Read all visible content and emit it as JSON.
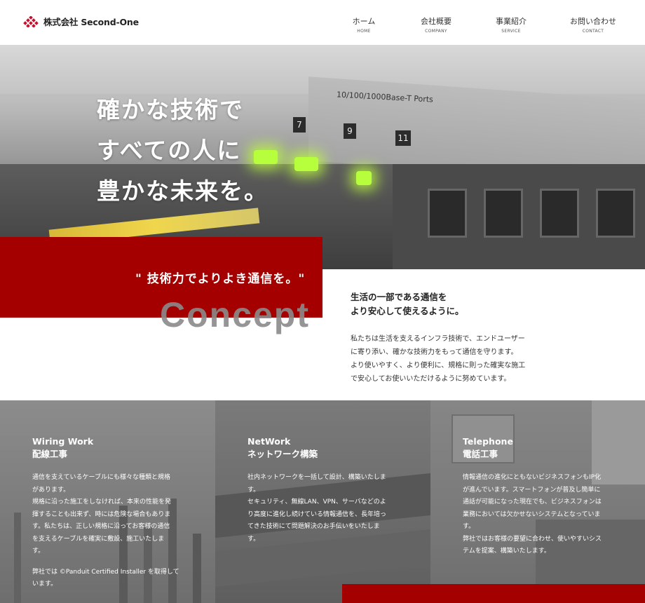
{
  "header": {
    "logo_text": "株式会社 Second-One",
    "nav": [
      {
        "jp": "ホーム",
        "en": "HOME"
      },
      {
        "jp": "会社概要",
        "en": "COMPANY"
      },
      {
        "jp": "事業紹介",
        "en": "SERVICE"
      },
      {
        "jp": "お問い合わせ",
        "en": "CONTACT"
      }
    ]
  },
  "hero": {
    "lines": [
      "確かな技術で",
      "すべての人に",
      "豊かな未来を。"
    ],
    "photo_label": "10/100/1000Base-T Ports",
    "port_numbers": [
      "7",
      "9",
      "11"
    ]
  },
  "concept": {
    "catch": "\" 技術力でよりよき通信を。\"",
    "title": "Concept",
    "heading": [
      "生活の一部である通信を",
      "より安心して使えるように。"
    ],
    "body": [
      "私たちは生活を支えるインフラ技術で、エンドユーザー",
      "に寄り添い、確かな技術力をもって通信を守ります。",
      "より使いやすく、より便利に、規格に則った確実な施工",
      "で安心してお使いいただけるように努めています。"
    ]
  },
  "services": [
    {
      "title_en": "Wiring Work",
      "title_jp": "配線工事",
      "body": [
        "通信を支えているケーブルにも様々な種類と規格",
        "があります。",
        "規格に沿った施工をしなければ、本来の性能を発",
        "揮することも出来ず、時には危険な場合もありま",
        "す。私たちは、正しい規格に沿ってお客様の通信",
        "を支えるケーブルを確実に敷設、施工いたしま",
        "す。",
        "",
        "弊社では ©Panduit Certified Installer を取得して",
        "います。"
      ]
    },
    {
      "title_en": "NetWork",
      "title_jp": "ネットワーク構築",
      "body": [
        "社内ネットワークを一括して設計、構築いたしま",
        "す。",
        "セキュリティ、無線LAN、VPN、サーバなどのよ",
        "り高度に進化し続けている情報通信を、長年培っ",
        "てきた技術にて問題解決のお手伝いをいたしま",
        "す。"
      ]
    },
    {
      "title_en": "Telephone",
      "title_jp": "電話工事",
      "body": [
        "情報通信の進化にともないビジネスフォンもIP化",
        "が進んでいます。スマートフォンが普及し簡単に",
        "通話が可能になった現在でも、ビジネスフォンは",
        "業務においては欠かせないシステムとなっていま",
        "す。",
        "弊社ではお客様の要望に合わせ、使いやすいシス",
        "テムを提案、構築いたします。"
      ]
    }
  ],
  "colors": {
    "accent_red": "#a50000",
    "logo_red": "#c8102e",
    "concept_title_gray": "#8a8a8a"
  }
}
